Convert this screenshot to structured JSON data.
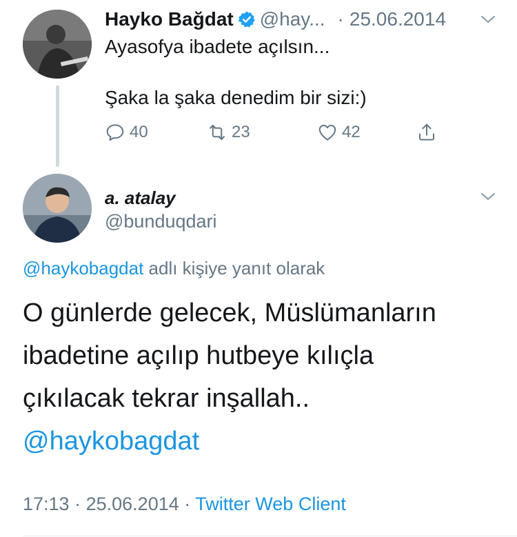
{
  "tweet1": {
    "name": "Hayko Bağdat",
    "handle": "@hay...",
    "date": "25.06.2014",
    "separator": "·",
    "lines": [
      "Ayasofya ibadete açılsın...",
      "Şaka la şaka denedim bir sizi:)"
    ],
    "replies": "40",
    "retweets": "23",
    "likes": "42"
  },
  "tweet2": {
    "name": "a. atalay",
    "handle": "@bunduqdari",
    "reply_to_mention": "@haykobagdat",
    "reply_to_text": " adlı kişiye yanıt olarak",
    "lines": [
      "O günlerde gelecek, Müslümanların",
      "ibadetine açılıp hutbeye kılıçla",
      "çıkılacak tekrar inşallah.."
    ],
    "mention": "@haykobagdat",
    "time": "17:13",
    "date": "25.06.2014",
    "source": "Twitter Web Client",
    "separator": "·"
  },
  "colors": {
    "accent": "#1b95e0",
    "muted": "#657786",
    "text": "#14171a"
  },
  "icons": [
    "verified-badge-icon",
    "chevron-down-icon",
    "reply-icon",
    "retweet-icon",
    "like-icon",
    "share-icon"
  ]
}
